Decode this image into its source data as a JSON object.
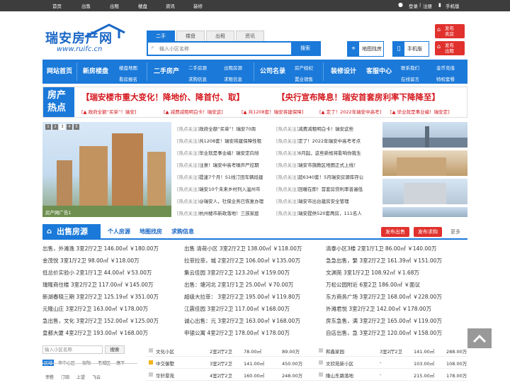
{
  "topbar": {
    "links": [
      "首页",
      "出售",
      "出租",
      "楼盘",
      "资讯",
      "装修"
    ],
    "login": "登录",
    "sep": "|",
    "register": "注册",
    "mobile": "手机版"
  },
  "logo": {
    "name": "瑞安房产网",
    "url": "www.ruifc.cn"
  },
  "search": {
    "tabs": [
      "二手",
      "楼盘",
      "出租",
      "资讯"
    ],
    "placeholder": "输入小区名称",
    "button": "搜索"
  },
  "header_buttons": {
    "map": "地图找房",
    "mobile": "手机版",
    "sell": [
      "发布",
      "卖房"
    ],
    "rent": [
      "发布",
      "出租"
    ]
  },
  "nav": {
    "home": "网站首页",
    "new": "新房楼盘",
    "second": "二手房产",
    "agents": "公司名录",
    "decor": "装修设计",
    "service": "客服中心",
    "sub_new": [
      "楼盘地图",
      "看房报名"
    ],
    "sub_second_a": [
      "二手房源",
      "求购信息"
    ],
    "sub_second_b": [
      "出租房源",
      "求租信息"
    ],
    "sub_agents": [
      "房产经纪",
      "置业销售"
    ],
    "sub_service_a": [
      "联系我们",
      "在线留言"
    ],
    "sub_service_b": [
      "金币充值",
      "特权套餐"
    ]
  },
  "hot": {
    "label1": "房产",
    "label2": "热点",
    "headline1": "【瑞安楼市重大变化！降地价、降首付、取】",
    "headline2": "【央行宣布降息！瑞安首套房利率下降降至】",
    "subs": [
      "[▲ 政府全额“买单”！瑞安]",
      "[▲ 减费减租明白卡！瑞安这]",
      "[▲ 共1208套！瑞安将建保障]",
      "[▲ 定了！2022年瑞安中高考]",
      "[▲ 毕业就是事业编！瑞安定]"
    ]
  },
  "slider": {
    "pages": [
      "1",
      "2",
      "3",
      "4",
      "5"
    ],
    "caption": "房产网广告1"
  },
  "headlines_left": [
    [
      "[热点关注]",
      "政府全额“买单”！瑞安70周"
    ],
    [
      "[热点关注]",
      "共1208套！瑞安将建保障性租"
    ],
    [
      "[热点关注]",
      "毕业就是事业编！瑞安定向培"
    ],
    [
      "[热点关注]",
      "注意！瑞安中高考噪声严控期"
    ],
    [
      "[热点关注]",
      "提速7个月！S1线汀田车辆段建"
    ],
    [
      "[热点关注]",
      "瑞安10个未来乡村列入温州市"
    ],
    [
      "[热点关注]",
      "@瑞安人，社保业务已恢复办理"
    ],
    [
      "[热点关注]",
      "杭州楼市新政落地！三孩家庭"
    ]
  ],
  "headlines_right": [
    [
      "[热点关注]",
      "减费减租明白卡！瑞安这些"
    ],
    [
      "[热点关注]",
      "定了！2022年瑞安中高考考点"
    ],
    [
      "[热点关注]",
      "6月起，这些新规将影响你我生"
    ],
    [
      "[热点关注]",
      "瑞安市施教区地图正式上线！"
    ],
    [
      "[热点关注]",
      "超6340套！5月瑞安房源库存公"
    ],
    [
      "[热点关注]",
      "回暖在即！首套房贷利率普遍低"
    ],
    [
      "[热点关注]",
      "瑞安市出台建房安全管理"
    ],
    [
      "[热点关注]",
      "瑞安提供520套两房，111名人"
    ]
  ],
  "section": {
    "title": "出售房源",
    "tabs": [
      "个人房源",
      "地图找房",
      "求购信息"
    ],
    "btn_sell": "发布出售",
    "btn_buy": "发布求购",
    "more": "更多"
  },
  "listings": [
    [
      "出售，外滩逸 3室2厅2卫 146.00㎡ ￥180.00万",
      "出售 清荷小区 3室2厅2卫 138.00㎡ ￥118.00万",
      "清泰小区3楼 2室1厅1卫 86.00㎡ ￥140.00万"
    ],
    [
      "金茂悦 3室1厅2卫 98.00㎡ ￥118.00万",
      "拉菲拉菲，城 2室2厅2卫 106.00㎡ ￥135.00万",
      "急急出售，繁 3室2厅2卫 161.39㎡ ￥151.00万"
    ],
    [
      "低总价实验小 2室1厅1卫 44.00㎡ ￥53.00万",
      "集云佳园 3室2厅2卫 123.20㎡ ￥159.00万",
      "文渊苑 3室1厅2卫 108.92㎡ ￥1.68万"
    ],
    [
      "瑞隆商住楼 3室2厅2卫 117.00㎡ ￥145.00万",
      "出售：塘河北 2室1厅1卫 25.00㎡ ￥70.00万",
      "万松公园附近 6室2卫 186.00㎡ ￥面议"
    ],
    [
      "新湖春晓三期 3室2厅2卫 125.19㎡ ￥351.00万",
      "超级大拉菲： 3室2厅2卫 195.00㎡ ￥119.80万",
      "东方商务广场 3室2厅2卫 168.00㎡ ￥228.00万"
    ],
    [
      "元隆山庄 3室2厅2卫 163.00㎡ ￥178.00万",
      "江震佳园 3室2厅2卫 117.00㎡ ￥168.00万",
      "外滩君悦 3室2厅2卫 142.00㎡ ￥178.00万"
    ],
    [
      "急出售，文化 3室2厅2卫 152.00㎡ ￥125.00万",
      "诚心出售：元 3室2厅2卫 163.00㎡ ￥168.00万",
      "房东急售，满 3室2厅2卫 165.00㎡ ￥119.00万"
    ],
    [
      "皇都大厦 4室2厅2卫 193.00㎡ ￥168.00万",
      "申银公寓 4室2厅2卫 178.00㎡ ￥178.00万",
      "自店出售，急 3室2厅2卫 120.00㎡ ￥158.00万"
    ]
  ],
  "bottom_search": {
    "placeholder": "输入小区名称",
    "button": "搜索",
    "areas": [
      "区域",
      "市中心区",
      "安阳",
      "老城区",
      "塘下"
    ],
    "areas2": [
      "莘塍",
      "汀田",
      "上望",
      "飞云"
    ]
  },
  "bottom_table": [
    [
      "文化小区",
      "2室2厅2卫",
      "78.00㎡",
      "89.00万",
      "和鑫家园",
      "3室2厅2卫",
      "141.00㎡",
      "288.00万"
    ],
    [
      "中交御墅",
      "3室2厅2卫",
      "141.00㎡",
      "450.00万",
      "文欣苑新小区",
      "-",
      "103.00㎡",
      "108.00万"
    ],
    [
      "华轩景苑",
      "4室2厅2卫",
      "160.00㎡",
      "248.00万",
      "隆山东路落地",
      "-",
      "215.00㎡",
      "178.00万"
    ]
  ],
  "colors": {
    "brand": "#1a79d9",
    "accent_red": "#e0312d",
    "hot_red": "#d4161c"
  }
}
